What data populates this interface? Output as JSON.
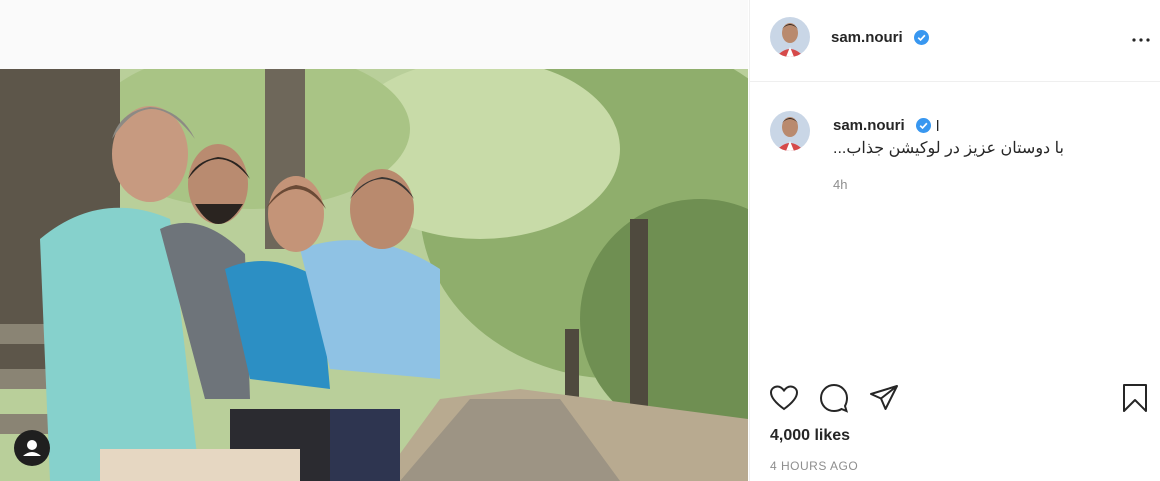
{
  "post": {
    "username": "sam.nouri",
    "caption_suffix": "l",
    "caption_text": "با دوستان عزیز در لوکیشن جذاب...",
    "time_short": "4h",
    "likes": "4,000 likes",
    "time_ago": "4 HOURS AGO"
  },
  "icons": {
    "verified": "verified-badge-icon",
    "more": "more-options-icon",
    "like": "heart-icon",
    "comment": "comment-icon",
    "share": "share-icon",
    "save": "bookmark-icon",
    "tag": "user-tag-icon"
  },
  "colors": {
    "verified": "#3897f0",
    "text": "#262626",
    "muted": "#8e8e8e"
  }
}
